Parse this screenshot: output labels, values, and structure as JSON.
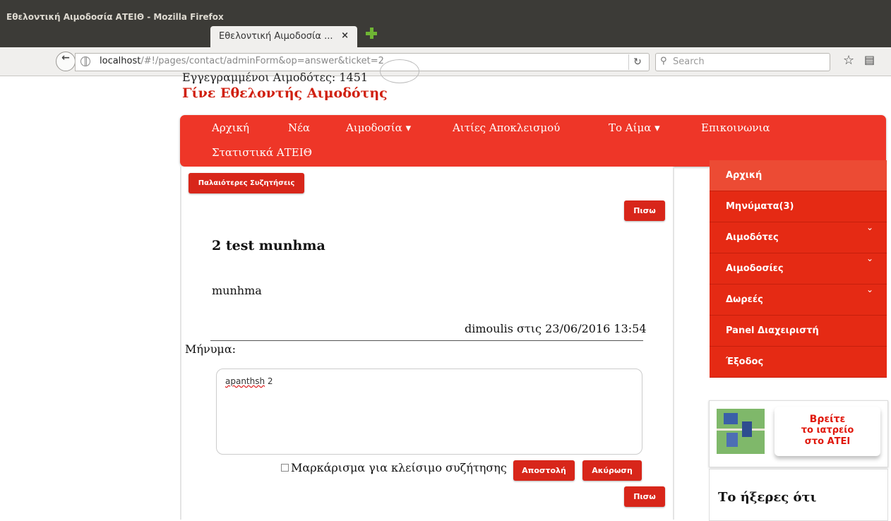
{
  "window": {
    "title": "Εθελοντική Αιμοδοσία ΑΤΕΙΘ - Mozilla Firefox"
  },
  "browser": {
    "tab_title": "Εθελοντική Αιμοδοσία ...",
    "tab_close": "×",
    "url_host": "localhost",
    "url_path": "/#!/pages/contact/adminForm&op=answer&ticket=2",
    "search_placeholder": "Search"
  },
  "header": {
    "registered": "Εγγεγραμμένοι Αιμοδότες: 1451",
    "slogan": "Γίνε Εθελοντής Αιμοδότης"
  },
  "nav": {
    "items": [
      {
        "label": "Αρχική"
      },
      {
        "label": "Νέα"
      },
      {
        "label": "Αιμοδοσία ▾"
      },
      {
        "label": "Αιτίες Αποκλεισμού"
      },
      {
        "label": "Το Αίμα ▾"
      },
      {
        "label": "Επικοινωνια"
      },
      {
        "label": "Στατιστικά ΑΤΕΙΘ"
      }
    ]
  },
  "content": {
    "older_button": "Παλαιότερες Συζητήσεις",
    "back_button": "Πισω",
    "message_title": "2 test munhma",
    "message_body": "munhma",
    "message_meta": "dimoulis στις 23/06/2016 13:54",
    "reply_label": "Μήνυμα:",
    "reply_value_word": "apanthsh",
    "reply_value_num": " 2",
    "close_checkbox_label": "Μαρκάρισμα για κλείσιμο συζήτησης",
    "send_button": "Αποστολή",
    "cancel_button": "Ακύρωση"
  },
  "sidebar": {
    "items": [
      {
        "label": "Αρχική",
        "active": true
      },
      {
        "label": "Μηνύματα(3)"
      },
      {
        "label": "Αιμοδότες",
        "expandable": true
      },
      {
        "label": "Αιμοδοσίες",
        "expandable": true
      },
      {
        "label": "Δωρεές",
        "expandable": true
      },
      {
        "label": "Panel Διαχειριστή"
      },
      {
        "label": "Έξοδος"
      }
    ],
    "clinic": {
      "line1": "Βρείτε",
      "line2": "το ιατρείο",
      "line3": "στο ΑΤΕΙ"
    },
    "did_you_know": "Το ήξερες ότι"
  },
  "colors": {
    "nav_red": "#ee3628",
    "menu_red": "#e52a14",
    "button_red": "#d8261a",
    "slogan_red": "#d02010"
  }
}
